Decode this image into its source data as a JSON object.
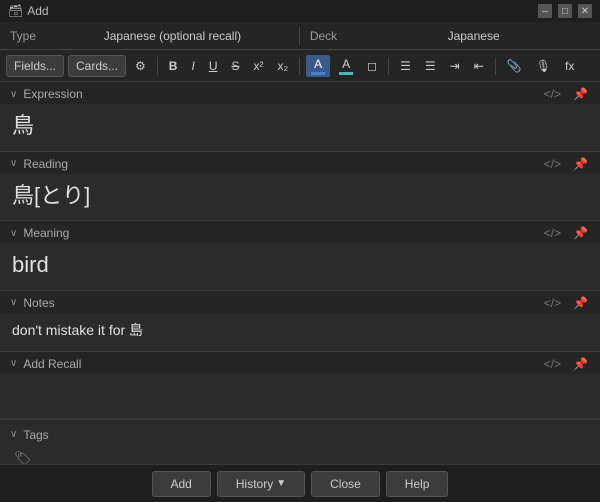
{
  "window": {
    "title": "Add",
    "minimize": "–",
    "maximize": "□",
    "close": "✕"
  },
  "type_row": {
    "type_label": "Type",
    "type_value": "Japanese (optional recall)",
    "deck_label": "Deck",
    "deck_value": "Japanese"
  },
  "toolbar": {
    "fields_btn": "Fields...",
    "cards_btn": "Cards...",
    "gear_icon": "⚙",
    "bold": "B",
    "italic": "I",
    "underline": "U",
    "strikethrough": "S",
    "superscript": "x²",
    "subscript": "x₂",
    "text_color_label": "A",
    "highlight_label": "A",
    "eraser": "◻",
    "list_ul": "≡",
    "list_ol": "≡",
    "indent": "≡",
    "outdent": "≡",
    "attach": "📎",
    "record": "🎤",
    "formula": "fx"
  },
  "fields": [
    {
      "name": "Expression",
      "content": "鳥",
      "size": "large"
    },
    {
      "name": "Reading",
      "content": "鳥[とり]",
      "size": "medium"
    },
    {
      "name": "Meaning",
      "content": "bird",
      "size": "medium"
    },
    {
      "name": "Notes",
      "content": "don't mistake it for 島",
      "size": "small"
    },
    {
      "name": "Add Recall",
      "content": "",
      "size": "small"
    }
  ],
  "tags": {
    "label": "Tags",
    "value": ""
  },
  "bottom_bar": {
    "add_label": "Add",
    "history_label": "History",
    "history_arrow": "▼",
    "close_label": "Close",
    "help_label": "Help"
  }
}
